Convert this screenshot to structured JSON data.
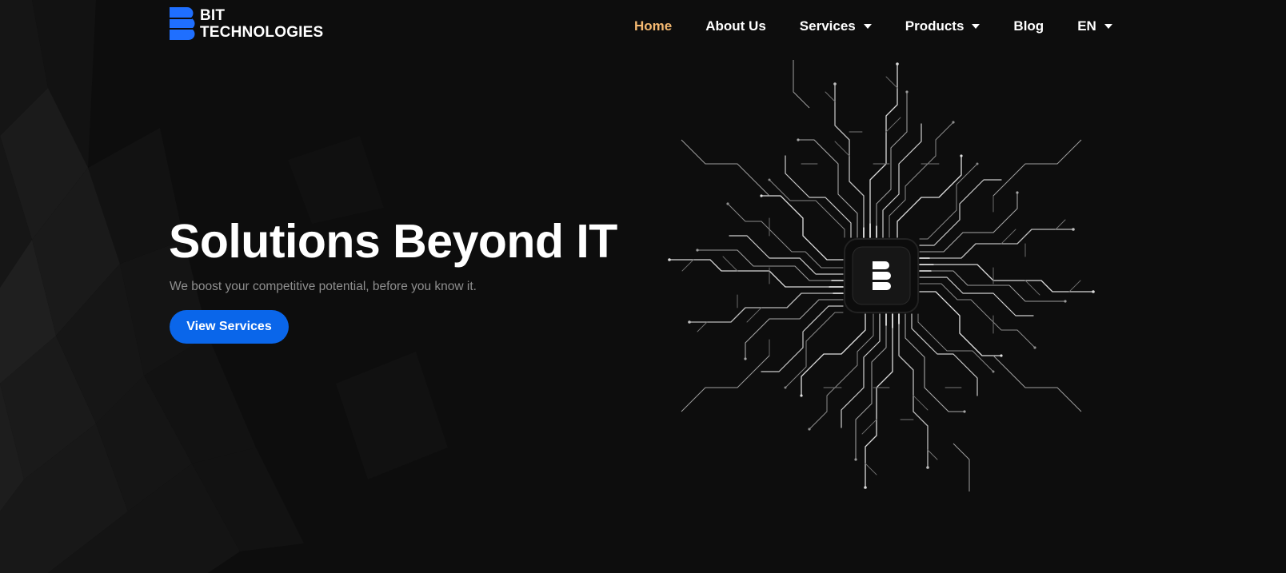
{
  "brand": {
    "line1": "BIT",
    "line2": "TECHNOLOGIES",
    "logo_icon": "b-logo-icon",
    "accent_color": "#1f6fff"
  },
  "nav": {
    "items": [
      {
        "label": "Home",
        "active": true
      },
      {
        "label": "About Us",
        "active": false
      },
      {
        "label": "Services",
        "active": false,
        "dropdown": true
      },
      {
        "label": "Products",
        "active": false,
        "dropdown": true
      },
      {
        "label": "Blog",
        "active": false
      },
      {
        "label": "EN",
        "active": false,
        "dropdown": true
      }
    ],
    "active_color": "#f5b971"
  },
  "hero": {
    "title": "Solutions Beyond IT",
    "subtitle": "We boost your competitive potential, before you know it.",
    "cta_label": "View Services",
    "cta_color": "#0a66ea"
  },
  "illustration": {
    "icon": "circuit-chip-icon"
  }
}
